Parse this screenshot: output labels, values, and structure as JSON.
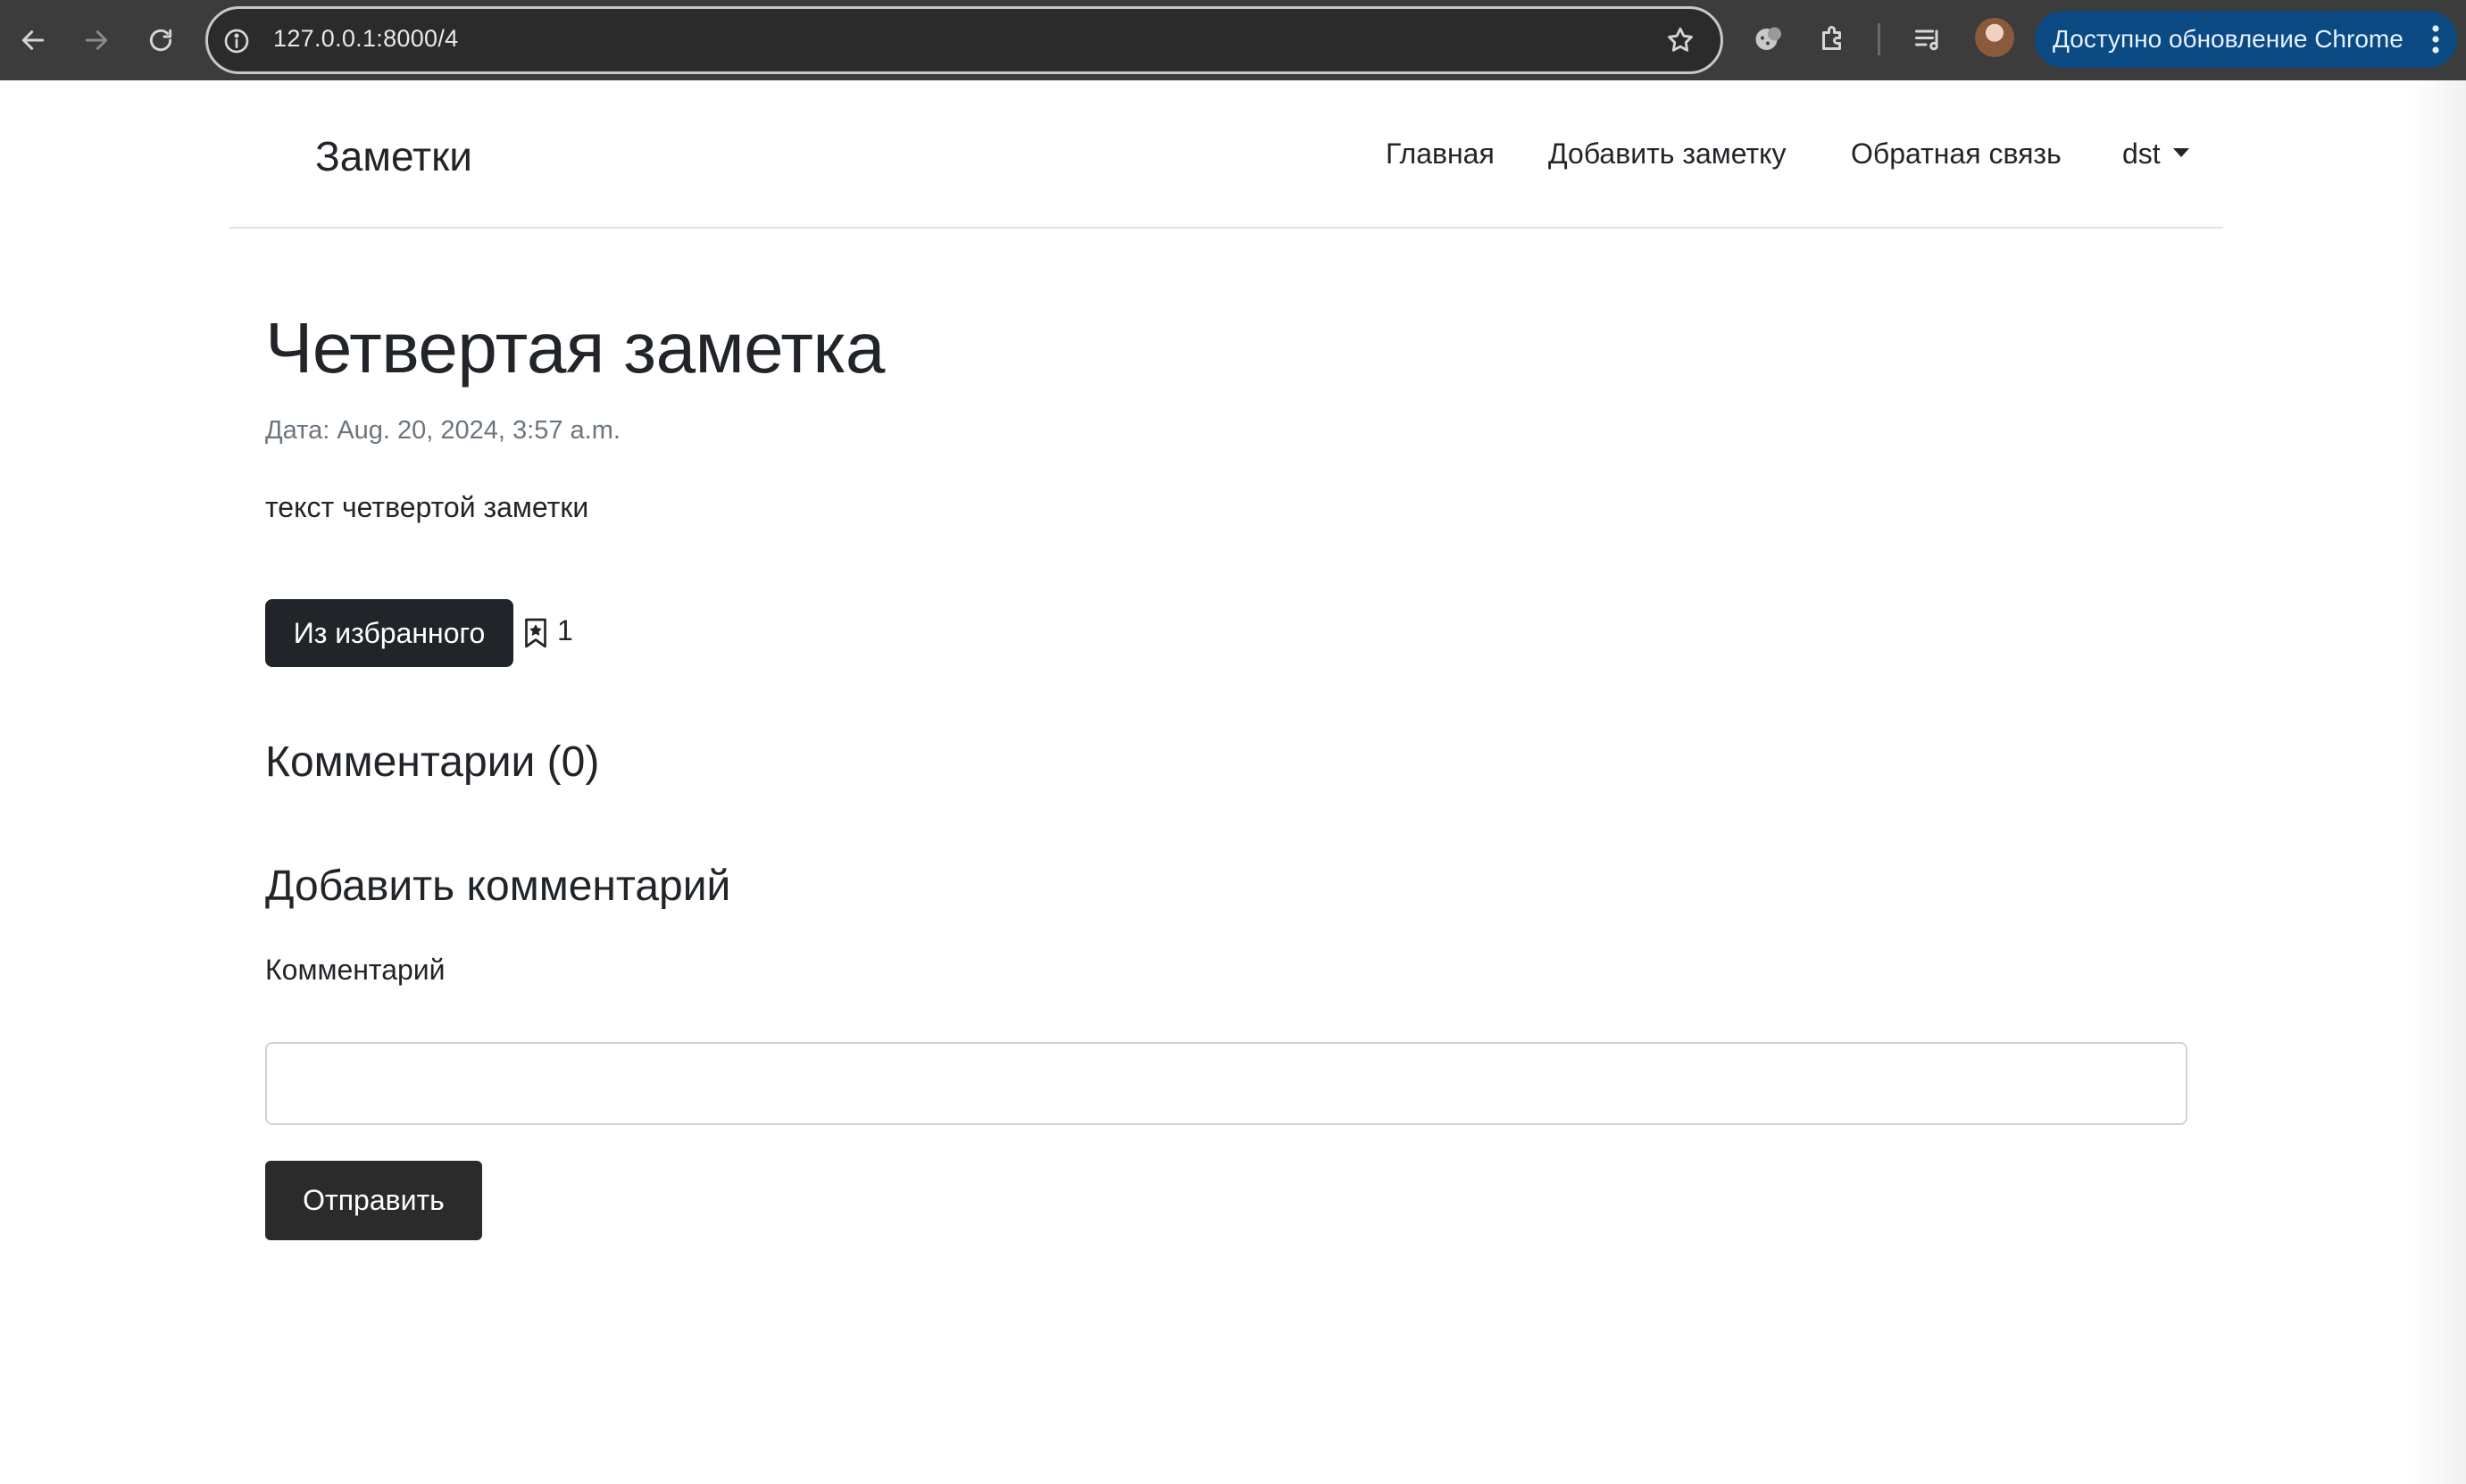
{
  "browser": {
    "url": "127.0.0.1:8000/4",
    "update_label": "Доступно обновление Chrome",
    "icons": {
      "back": "arrow-left-icon",
      "forward": "arrow-right-icon",
      "reload": "reload-icon",
      "site_info": "info-icon",
      "bookmark": "star-icon",
      "extension_a": "cookie-icon",
      "extension_b": "puzzle-icon",
      "media": "media-queue-icon",
      "menu": "kebab-icon"
    }
  },
  "header": {
    "brand": "Заметки",
    "nav": {
      "home": "Главная",
      "add_note": "Добавить заметку",
      "feedback": "Обратная связь",
      "user": "dst"
    }
  },
  "note": {
    "title": "Четвертая заметка",
    "date": "Дата: Aug. 20, 2024, 3:57 a.m.",
    "text": "текст четвертой заметки",
    "favorite_button": "Из избранного",
    "favorite_count": "1"
  },
  "comments": {
    "heading": "Комментарии (0)",
    "add_heading": "Добавить комментарий",
    "field_label": "Комментарий",
    "input_value": "",
    "submit_label": "Отправить"
  },
  "colors": {
    "chrome_bg": "#3c3c3c",
    "update_pill": "#0b4a82",
    "button_dark": "#212529",
    "muted_text": "#6c757d"
  }
}
